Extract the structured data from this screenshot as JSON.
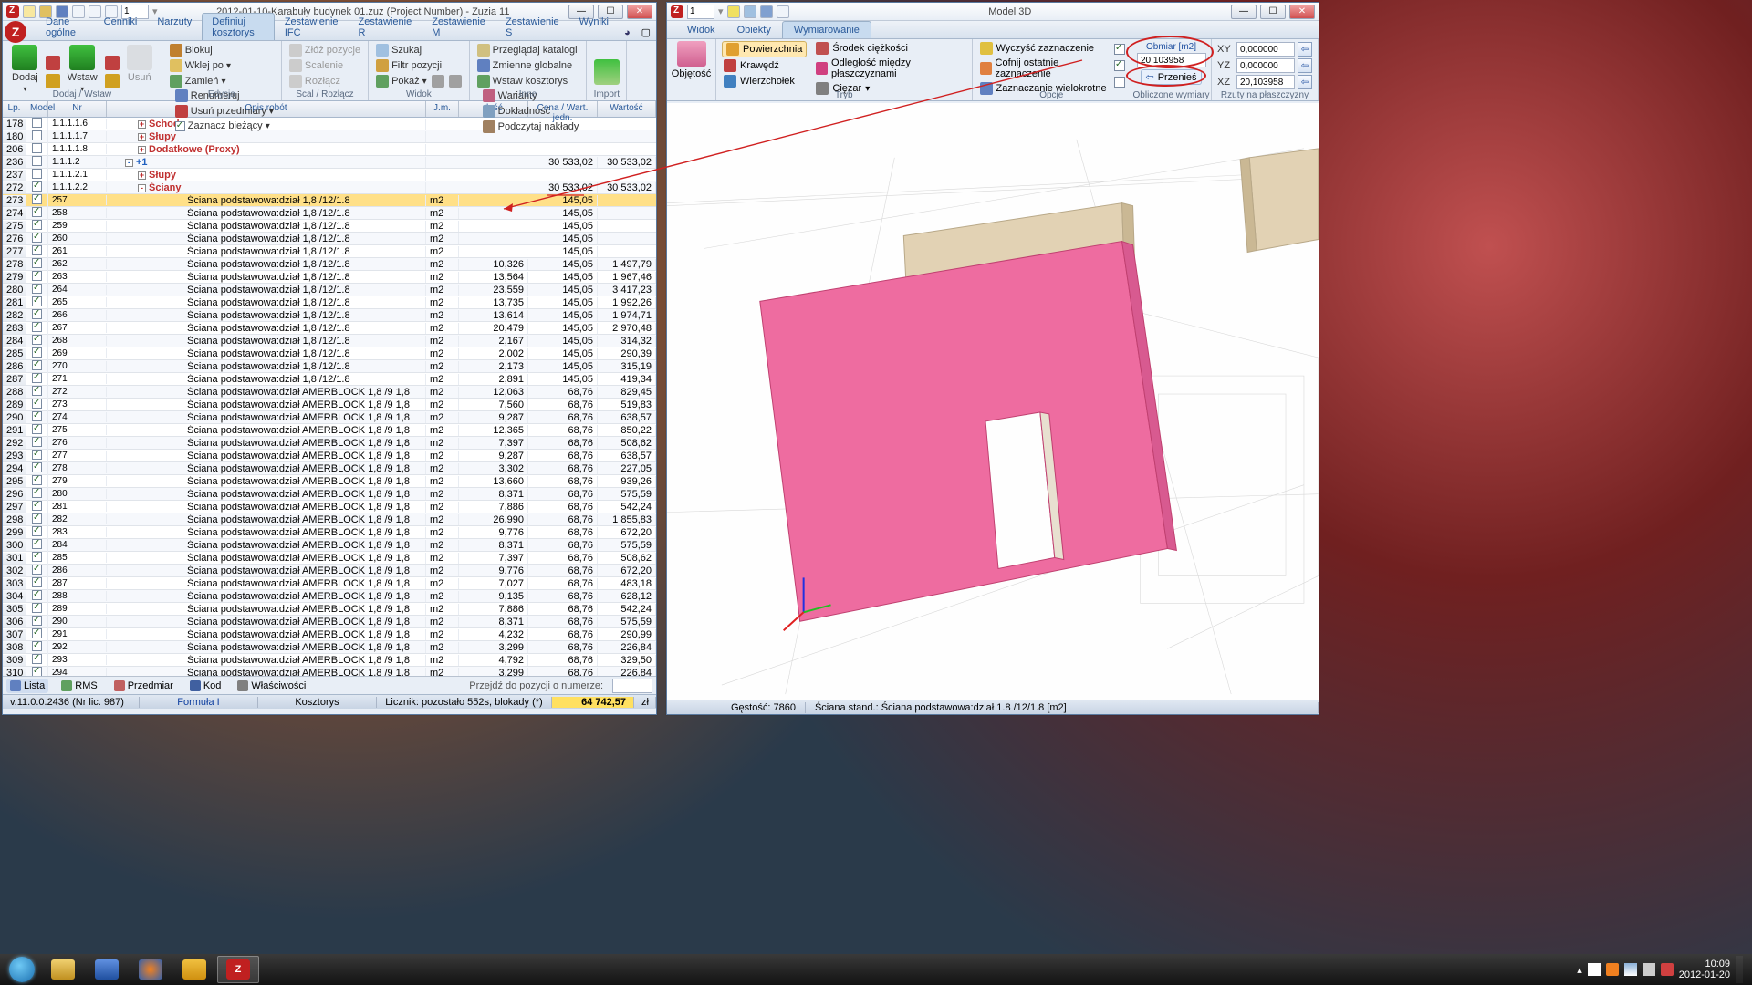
{
  "left": {
    "title": "2012-01-10-Karabuły budynek 01.zuz (Project Number) - Zuzia 11",
    "qat_spin": "1",
    "tabs": [
      "Dane ogólne",
      "Cenniki",
      "Narzuty",
      "Definiuj kosztorys",
      "Zestawienie IFC",
      "Zestawienie R",
      "Zestawienie M",
      "Zestawienie S",
      "Wyniki"
    ],
    "tab_active": 3,
    "ribbon": {
      "dodaj": {
        "big1": "Dodaj",
        "big2": "Wstaw",
        "big3": "Usuń",
        "label": "Dodaj / Wstaw"
      },
      "edycja": {
        "items": [
          "Blokuj",
          "Wklej po",
          "Zamień",
          "Renumeruj",
          "Usuń przedmiary",
          "Zaznacz bieżący"
        ],
        "label": "Edycja"
      },
      "scal": {
        "items": [
          "Złóż pozycje",
          "Scalenie",
          "Rozłącz"
        ],
        "label": "Scal / Rozłącz"
      },
      "widok": {
        "items": [
          "Szukaj",
          "Filtr pozycji",
          "Pokaż"
        ],
        "label": "Widok"
      },
      "inne": {
        "items": [
          "Przeglądaj katalogi",
          "Zmienne globalne",
          "Wstaw kosztorys",
          "Warianty",
          "Dokładność",
          "Podczytaj nakłady"
        ],
        "label": "Inne"
      },
      "import": {
        "label": "Import"
      }
    },
    "grid_headers": {
      "lp": "Lp.",
      "model": "Model",
      "nr": "Nr",
      "opis": "Opis robót",
      "jm": "J.m.",
      "ilosc": "Ilość",
      "cena": "Cena / Wart. jedn.",
      "wart": "Wartość"
    },
    "rows": [
      {
        "lp": "178",
        "chk": false,
        "nr": "1.1.1.1.6",
        "opis": "Schody",
        "cat": true,
        "indent": 2,
        "btn": "+"
      },
      {
        "lp": "180",
        "chk": false,
        "nr": "1.1.1.1.7",
        "opis": "Słupy",
        "cat": true,
        "indent": 2,
        "btn": "+"
      },
      {
        "lp": "206",
        "chk": false,
        "nr": "1.1.1.1.8",
        "opis": "Dodatkowe (Proxy)",
        "cat": true,
        "indent": 2,
        "btn": "+"
      },
      {
        "lp": "236",
        "chk": false,
        "nr": "1.1.1.2",
        "opis": "+1",
        "catblue": true,
        "indent": 1,
        "btn": "-",
        "cena": "30 533,02",
        "wart": "30 533,02"
      },
      {
        "lp": "237",
        "chk": false,
        "nr": "1.1.1.2.1",
        "opis": "Słupy",
        "cat": true,
        "indent": 2,
        "btn": "+"
      },
      {
        "lp": "272",
        "chk": true,
        "nr": "1.1.1.2.2",
        "opis": "Ściany",
        "cat": true,
        "indent": 2,
        "btn": "-",
        "cena": "30 533,02",
        "wart": "30 533,02"
      },
      {
        "lp": "273",
        "chk": true,
        "nr": "257",
        "opis": "Ściana podstawowa:dział 1,8 /12/1.8",
        "jm": "m2",
        "cena": "145,05",
        "sel": true,
        "indent": 3
      },
      {
        "lp": "274",
        "chk": true,
        "nr": "258",
        "opis": "Ściana podstawowa:dział 1,8 /12/1.8",
        "jm": "m2",
        "cena": "145,05",
        "indent": 3
      },
      {
        "lp": "275",
        "chk": true,
        "nr": "259",
        "opis": "Ściana podstawowa:dział 1,8 /12/1.8",
        "jm": "m2",
        "cena": "145,05",
        "indent": 3
      },
      {
        "lp": "276",
        "chk": true,
        "nr": "260",
        "opis": "Ściana podstawowa:dział 1,8 /12/1.8",
        "jm": "m2",
        "cena": "145,05",
        "indent": 3
      },
      {
        "lp": "277",
        "chk": true,
        "nr": "261",
        "opis": "Ściana podstawowa:dział 1,8 /12/1.8",
        "jm": "m2",
        "cena": "145,05",
        "indent": 3
      },
      {
        "lp": "278",
        "chk": true,
        "nr": "262",
        "opis": "Ściana podstawowa:dział 1,8 /12/1.8",
        "jm": "m2",
        "ilosc": "10,326",
        "cena": "145,05",
        "wart": "1 497,79",
        "indent": 3
      },
      {
        "lp": "279",
        "chk": true,
        "nr": "263",
        "opis": "Ściana podstawowa:dział 1,8 /12/1.8",
        "jm": "m2",
        "ilosc": "13,564",
        "cena": "145,05",
        "wart": "1 967,46",
        "indent": 3
      },
      {
        "lp": "280",
        "chk": true,
        "nr": "264",
        "opis": "Ściana podstawowa:dział 1,8 /12/1.8",
        "jm": "m2",
        "ilosc": "23,559",
        "cena": "145,05",
        "wart": "3 417,23",
        "indent": 3
      },
      {
        "lp": "281",
        "chk": true,
        "nr": "265",
        "opis": "Ściana podstawowa:dział 1,8 /12/1.8",
        "jm": "m2",
        "ilosc": "13,735",
        "cena": "145,05",
        "wart": "1 992,26",
        "indent": 3
      },
      {
        "lp": "282",
        "chk": true,
        "nr": "266",
        "opis": "Ściana podstawowa:dział 1,8 /12/1.8",
        "jm": "m2",
        "ilosc": "13,614",
        "cena": "145,05",
        "wart": "1 974,71",
        "indent": 3
      },
      {
        "lp": "283",
        "chk": true,
        "nr": "267",
        "opis": "Ściana podstawowa:dział 1,8 /12/1.8",
        "jm": "m2",
        "ilosc": "20,479",
        "cena": "145,05",
        "wart": "2 970,48",
        "indent": 3
      },
      {
        "lp": "284",
        "chk": true,
        "nr": "268",
        "opis": "Ściana podstawowa:dział 1,8 /12/1.8",
        "jm": "m2",
        "ilosc": "2,167",
        "cena": "145,05",
        "wart": "314,32",
        "indent": 3
      },
      {
        "lp": "285",
        "chk": true,
        "nr": "269",
        "opis": "Ściana podstawowa:dział 1,8 /12/1.8",
        "jm": "m2",
        "ilosc": "2,002",
        "cena": "145,05",
        "wart": "290,39",
        "indent": 3
      },
      {
        "lp": "286",
        "chk": true,
        "nr": "270",
        "opis": "Ściana podstawowa:dział 1,8 /12/1.8",
        "jm": "m2",
        "ilosc": "2,173",
        "cena": "145,05",
        "wart": "315,19",
        "indent": 3
      },
      {
        "lp": "287",
        "chk": true,
        "nr": "271",
        "opis": "Ściana podstawowa:dział 1,8 /12/1.8",
        "jm": "m2",
        "ilosc": "2,891",
        "cena": "145,05",
        "wart": "419,34",
        "indent": 3
      },
      {
        "lp": "288",
        "chk": true,
        "nr": "272",
        "opis": "Ściana podstawowa:dział AMERBLOCK 1,8 /9 1,8",
        "jm": "m2",
        "ilosc": "12,063",
        "cena": "68,76",
        "wart": "829,45",
        "indent": 3
      },
      {
        "lp": "289",
        "chk": true,
        "nr": "273",
        "opis": "Ściana podstawowa:dział AMERBLOCK 1,8 /9 1,8",
        "jm": "m2",
        "ilosc": "7,560",
        "cena": "68,76",
        "wart": "519,83",
        "indent": 3
      },
      {
        "lp": "290",
        "chk": true,
        "nr": "274",
        "opis": "Ściana podstawowa:dział AMERBLOCK 1,8 /9 1,8",
        "jm": "m2",
        "ilosc": "9,287",
        "cena": "68,76",
        "wart": "638,57",
        "indent": 3
      },
      {
        "lp": "291",
        "chk": true,
        "nr": "275",
        "opis": "Ściana podstawowa:dział AMERBLOCK 1,8 /9 1,8",
        "jm": "m2",
        "ilosc": "12,365",
        "cena": "68,76",
        "wart": "850,22",
        "indent": 3
      },
      {
        "lp": "292",
        "chk": true,
        "nr": "276",
        "opis": "Ściana podstawowa:dział AMERBLOCK 1,8 /9 1,8",
        "jm": "m2",
        "ilosc": "7,397",
        "cena": "68,76",
        "wart": "508,62",
        "indent": 3
      },
      {
        "lp": "293",
        "chk": true,
        "nr": "277",
        "opis": "Ściana podstawowa:dział AMERBLOCK 1,8 /9 1,8",
        "jm": "m2",
        "ilosc": "9,287",
        "cena": "68,76",
        "wart": "638,57",
        "indent": 3
      },
      {
        "lp": "294",
        "chk": true,
        "nr": "278",
        "opis": "Ściana podstawowa:dział AMERBLOCK 1,8 /9 1,8",
        "jm": "m2",
        "ilosc": "3,302",
        "cena": "68,76",
        "wart": "227,05",
        "indent": 3
      },
      {
        "lp": "295",
        "chk": true,
        "nr": "279",
        "opis": "Ściana podstawowa:dział AMERBLOCK 1,8 /9 1,8",
        "jm": "m2",
        "ilosc": "13,660",
        "cena": "68,76",
        "wart": "939,26",
        "indent": 3
      },
      {
        "lp": "296",
        "chk": true,
        "nr": "280",
        "opis": "Ściana podstawowa:dział AMERBLOCK 1,8 /9 1,8",
        "jm": "m2",
        "ilosc": "8,371",
        "cena": "68,76",
        "wart": "575,59",
        "indent": 3
      },
      {
        "lp": "297",
        "chk": true,
        "nr": "281",
        "opis": "Ściana podstawowa:dział AMERBLOCK 1,8 /9 1,8",
        "jm": "m2",
        "ilosc": "7,886",
        "cena": "68,76",
        "wart": "542,24",
        "indent": 3
      },
      {
        "lp": "298",
        "chk": true,
        "nr": "282",
        "opis": "Ściana podstawowa:dział AMERBLOCK 1,8 /9 1,8",
        "jm": "m2",
        "ilosc": "26,990",
        "cena": "68,76",
        "wart": "1 855,83",
        "indent": 3
      },
      {
        "lp": "299",
        "chk": true,
        "nr": "283",
        "opis": "Ściana podstawowa:dział AMERBLOCK 1,8 /9 1,8",
        "jm": "m2",
        "ilosc": "9,776",
        "cena": "68,76",
        "wart": "672,20",
        "indent": 3
      },
      {
        "lp": "300",
        "chk": true,
        "nr": "284",
        "opis": "Ściana podstawowa:dział AMERBLOCK 1,8 /9 1,8",
        "jm": "m2",
        "ilosc": "8,371",
        "cena": "68,76",
        "wart": "575,59",
        "indent": 3
      },
      {
        "lp": "301",
        "chk": true,
        "nr": "285",
        "opis": "Ściana podstawowa:dział AMERBLOCK 1,8 /9 1,8",
        "jm": "m2",
        "ilosc": "7,397",
        "cena": "68,76",
        "wart": "508,62",
        "indent": 3
      },
      {
        "lp": "302",
        "chk": true,
        "nr": "286",
        "opis": "Ściana podstawowa:dział AMERBLOCK 1,8 /9 1,8",
        "jm": "m2",
        "ilosc": "9,776",
        "cena": "68,76",
        "wart": "672,20",
        "indent": 3
      },
      {
        "lp": "303",
        "chk": true,
        "nr": "287",
        "opis": "Ściana podstawowa:dział AMERBLOCK 1,8 /9 1,8",
        "jm": "m2",
        "ilosc": "7,027",
        "cena": "68,76",
        "wart": "483,18",
        "indent": 3
      },
      {
        "lp": "304",
        "chk": true,
        "nr": "288",
        "opis": "Ściana podstawowa:dział AMERBLOCK 1,8 /9 1,8",
        "jm": "m2",
        "ilosc": "9,135",
        "cena": "68,76",
        "wart": "628,12",
        "indent": 3
      },
      {
        "lp": "305",
        "chk": true,
        "nr": "289",
        "opis": "Ściana podstawowa:dział AMERBLOCK 1,8 /9 1,8",
        "jm": "m2",
        "ilosc": "7,886",
        "cena": "68,76",
        "wart": "542,24",
        "indent": 3
      },
      {
        "lp": "306",
        "chk": true,
        "nr": "290",
        "opis": "Ściana podstawowa:dział AMERBLOCK 1,8 /9 1,8",
        "jm": "m2",
        "ilosc": "8,371",
        "cena": "68,76",
        "wart": "575,59",
        "indent": 3
      },
      {
        "lp": "307",
        "chk": true,
        "nr": "291",
        "opis": "Ściana podstawowa:dział AMERBLOCK 1,8 /9 1,8",
        "jm": "m2",
        "ilosc": "4,232",
        "cena": "68,76",
        "wart": "290,99",
        "indent": 3
      },
      {
        "lp": "308",
        "chk": true,
        "nr": "292",
        "opis": "Ściana podstawowa:dział AMERBLOCK 1,8 /9 1,8",
        "jm": "m2",
        "ilosc": "3,299",
        "cena": "68,76",
        "wart": "226,84",
        "indent": 3
      },
      {
        "lp": "309",
        "chk": true,
        "nr": "293",
        "opis": "Ściana podstawowa:dział AMERBLOCK 1,8 /9 1,8",
        "jm": "m2",
        "ilosc": "4,792",
        "cena": "68,76",
        "wart": "329,50",
        "indent": 3
      },
      {
        "lp": "310",
        "chk": true,
        "nr": "294",
        "opis": "Ściana podstawowa:dział AMERBLOCK 1,8 /9 1,8",
        "jm": "m2",
        "ilosc": "3,299",
        "cena": "68,76",
        "wart": "226,84",
        "indent": 3
      }
    ],
    "bottom_tabs": [
      "Lista",
      "RMS",
      "Przedmiar",
      "Kod",
      "Właściwości"
    ],
    "goto": "Przejdź do pozycji o numerze:",
    "status": {
      "ver": "v.11.0.0.2436 (Nr lic. 987)",
      "formula": "Formuła I",
      "kosztorys": "Kosztorys",
      "licznik": "Licznik: pozostało 552s, blokady  (*)",
      "suma": "64 742,57",
      "cur": "zł"
    }
  },
  "right": {
    "title": "Model 3D",
    "qat_spin": "1",
    "tabs": [
      "Widok",
      "Obiekty",
      "Wymiarowanie"
    ],
    "tab_active": 2,
    "ribbon": {
      "objetosc_label": "Objętość",
      "tryb": {
        "items": [
          "Powierzchnia",
          "Krawędź",
          "Wierzchołek",
          "Środek ciężkości",
          "Odległość między płaszczyznami",
          "Ciężar"
        ],
        "label": "Tryb"
      },
      "opcje": {
        "items": [
          "Wyczyść zaznaczenie",
          "Cofnij ostatnie zaznaczenie",
          "Zaznaczanie wielokrotne"
        ],
        "label": "Opcje"
      },
      "obliczone": {
        "obmiar": "Obmiar [m2]",
        "val": "20,103958",
        "przenies": "Przenieś",
        "label": "Obliczone wymiary"
      },
      "rzuty": {
        "xy": "XY",
        "yz": "YZ",
        "xz": "XZ",
        "v_xy": "0,000000",
        "v_yz": "0,000000",
        "v_xz": "20,103958",
        "label": "Rzuty na płaszczyzny"
      }
    },
    "status": {
      "gestosc": "Gęstość: 7860",
      "sciana": "Ściana stand.: Ściana podstawowa:dział 1.8 /12/1.8 [m2]"
    }
  },
  "taskbar": {
    "time": "10:09",
    "date": "2012-01-20"
  }
}
